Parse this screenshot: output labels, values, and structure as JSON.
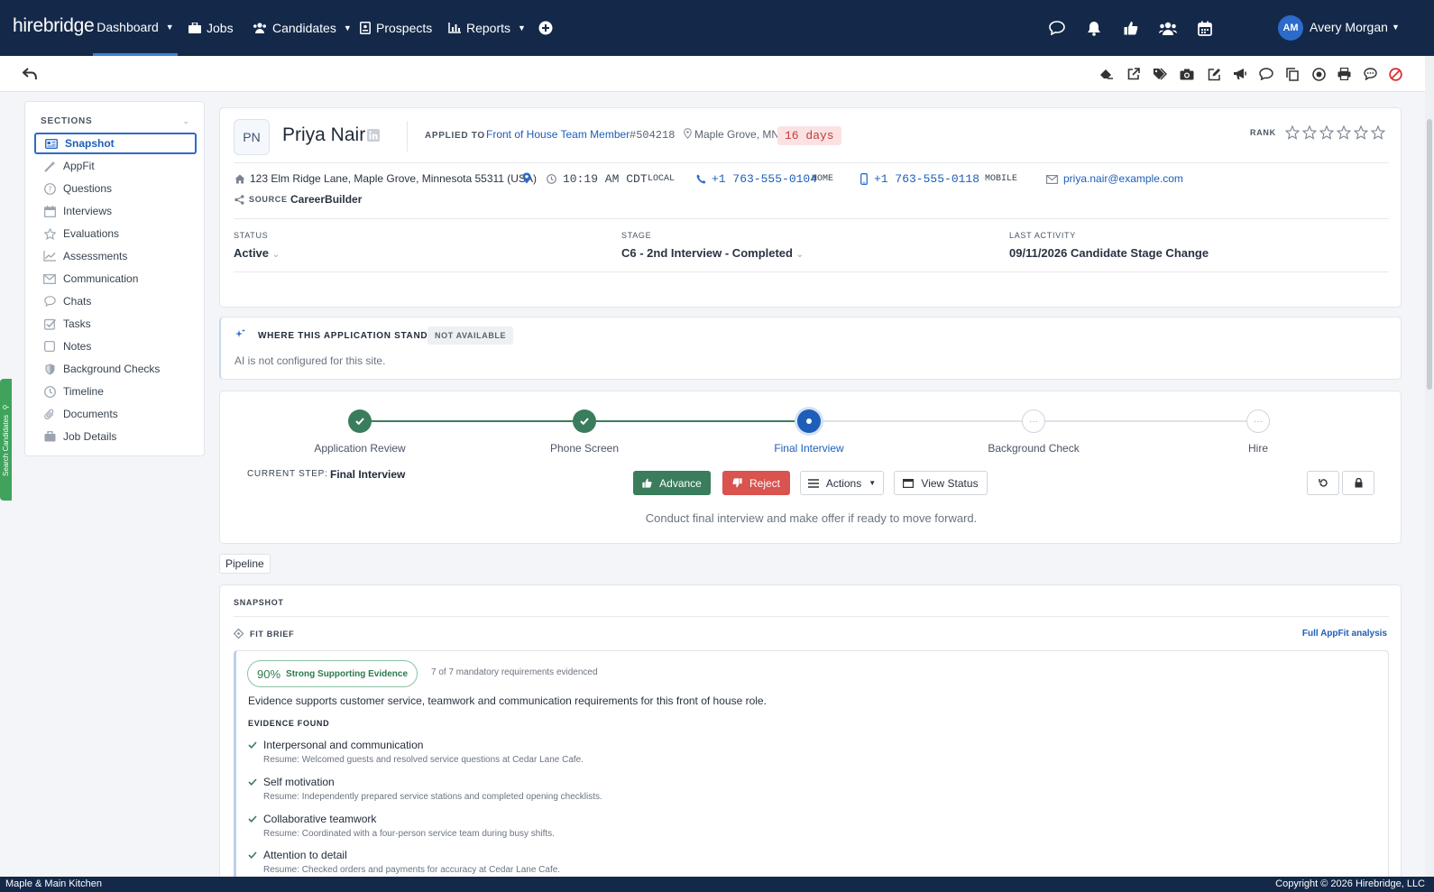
{
  "app": {
    "logo": "hirebridge"
  },
  "nav": {
    "dashboard": "Dashboard",
    "jobs": "Jobs",
    "candidates": "Candidates",
    "prospects": "Prospects",
    "reports": "Reports"
  },
  "user": {
    "initials": "AM",
    "name": "Avery Morgan"
  },
  "sidebar": {
    "heading": "SECTIONS",
    "items": [
      {
        "label": "Snapshot",
        "icon": "snapshot-icon"
      },
      {
        "label": "AppFit",
        "icon": "wand-icon"
      },
      {
        "label": "Questions",
        "icon": "question-icon"
      },
      {
        "label": "Interviews",
        "icon": "calendar-icon"
      },
      {
        "label": "Evaluations",
        "icon": "star-icon"
      },
      {
        "label": "Assessments",
        "icon": "chart-icon"
      },
      {
        "label": "Communication",
        "icon": "envelope-icon"
      },
      {
        "label": "Chats",
        "icon": "chat-icon"
      },
      {
        "label": "Tasks",
        "icon": "checkbox-icon"
      },
      {
        "label": "Notes",
        "icon": "note-icon"
      },
      {
        "label": "Background Checks",
        "icon": "shield-icon"
      },
      {
        "label": "Timeline",
        "icon": "clock-icon"
      },
      {
        "label": "Documents",
        "icon": "paperclip-icon"
      },
      {
        "label": "Job Details",
        "icon": "briefcase-icon"
      }
    ]
  },
  "side_tab": "Search Candidates",
  "candidate": {
    "initials": "PN",
    "name": "Priya Nair",
    "applied_to_label": "APPLIED TO",
    "job_title": "Front of House Team Member",
    "job_id": "#504218",
    "location": "Maple Grove, MN",
    "days": "16 days",
    "rank_label": "RANK",
    "rank_value": 0,
    "address": "123 Elm Ridge Lane, Maple Grove, Minnesota 55311 (USA)",
    "local_time": "10:19 AM CDT",
    "local_label": "LOCAL",
    "home_phone": "+1 763-555-0104",
    "home_label": "HOME",
    "mobile_phone": "+1 763-555-0118",
    "mobile_label": "MOBILE",
    "email": "priya.nair@example.com",
    "source_label": "SOURCE",
    "source": "CareerBuilder",
    "status_label": "STATUS",
    "status": "Active",
    "stage_label": "STAGE",
    "stage": "C6 - 2nd Interview - Completed",
    "last_activity_label": "LAST ACTIVITY",
    "last_activity": "09/11/2026 Candidate Stage Change"
  },
  "ai": {
    "heading": "WHERE THIS APPLICATION STANDS",
    "badge": "NOT AVAILABLE",
    "message": "AI is not configured for this site."
  },
  "workflow": {
    "steps": [
      {
        "label": "Application Review",
        "state": "done"
      },
      {
        "label": "Phone Screen",
        "state": "done"
      },
      {
        "label": "Final Interview",
        "state": "current"
      },
      {
        "label": "Background Check",
        "state": "pending"
      },
      {
        "label": "Hire",
        "state": "pending"
      }
    ],
    "current_step_label": "CURRENT STEP:",
    "current_step": "Final Interview",
    "advance": "Advance",
    "reject": "Reject",
    "actions": "Actions",
    "view_status": "View Status",
    "hint": "Conduct final interview and make offer if ready to move forward."
  },
  "pipeline_tab": "Pipeline",
  "snapshot": {
    "heading": "SNAPSHOT",
    "fit_brief": "FIT BRIEF",
    "full_analysis": "Full AppFit analysis",
    "score": "90%",
    "score_label": "Strong Supporting Evidence",
    "requirements": "7 of 7 mandatory requirements evidenced",
    "summary": "Evidence supports customer service, teamwork and communication requirements for this front of house role.",
    "evidence_heading": "EVIDENCE FOUND",
    "evidence": [
      {
        "title": "Interpersonal and communication",
        "detail": "Resume: Welcomed guests and resolved service questions at Cedar Lane Cafe."
      },
      {
        "title": "Self motivation",
        "detail": "Resume: Independently prepared service stations and completed opening checklists."
      },
      {
        "title": "Collaborative teamwork",
        "detail": "Resume: Coordinated with a four-person service team during busy shifts."
      },
      {
        "title": "Attention to detail",
        "detail": "Resume: Checked orders and payments for accuracy at Cedar Lane Cafe."
      }
    ]
  },
  "footer": {
    "company": "Maple & Main Kitchen",
    "copyright": "Copyright © 2026 Hirebridge, LLC"
  },
  "colors": {
    "nav_bg": "#14294a",
    "accent": "#2c6bc9",
    "success": "#3a7d5c",
    "danger": "#d9534f"
  }
}
